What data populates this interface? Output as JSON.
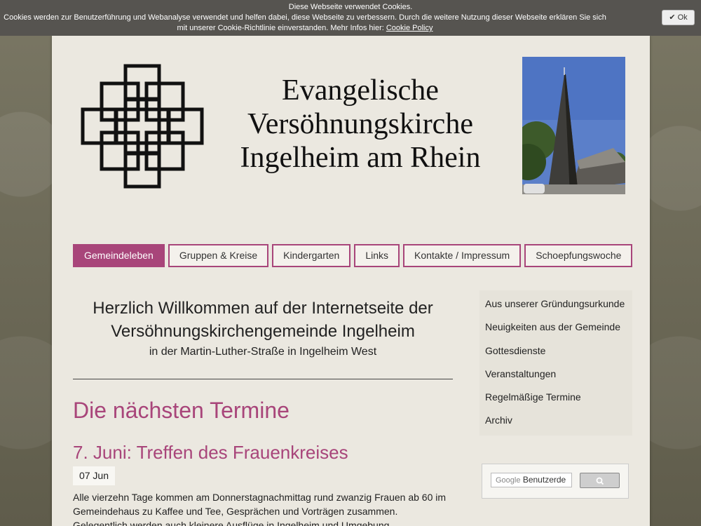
{
  "cookie": {
    "title": "Diese Webseite verwendet Cookies.",
    "text": "Cookies werden zur Benutzerführung und Webanalyse verwendet und helfen dabei, diese Webseite zu verbessern. Durch die weitere Nutzung dieser Webseite erklären Sie sich mit unserer Cookie-Richtlinie einverstanden. Mehr Infos hier: ",
    "link": "Cookie Policy",
    "ok_label": "Ok"
  },
  "header": {
    "line1": "Evangelische",
    "line2": "Versöhnungskirche",
    "line3": "Ingelheim am Rhein"
  },
  "nav": {
    "items": [
      "Gemeindeleben",
      "Gruppen & Kreise",
      "Kindergarten",
      "Links",
      "Kontakte / Impressum",
      "Schoepfungswoche"
    ]
  },
  "main": {
    "welcome_line1": "Herzlich Willkommen auf der Internetseite der",
    "welcome_line2": "Versöhnungskirchengemeinde Ingelheim",
    "welcome_sub": "in der Martin-Luther-Straße in Ingelheim West",
    "section_title": "Die nächsten Termine",
    "event_title": "7. Juni: Treffen des Frauenkreises",
    "event_date": "07  Jun",
    "event_text": "Alle vierzehn Tage kommen am Donnerstagnachmittag rund zwanzig Frauen ab 60 im Gemeindehaus zu Kaffee und Tee, Gesprächen und Vorträgen zusammen. Gelegentlich werden auch kleinere Ausflüge in Ingelheim und Umgebung unternommen. Folgende"
  },
  "sidebar": {
    "items": [
      "Aus unserer Gründungsurkunde",
      "Neuigkeiten aus der Gemeinde",
      "Gottesdienste",
      "Veranstaltungen",
      "Regelmäßige Termine",
      "Archiv"
    ],
    "search_brand": "Google",
    "search_placeholder": "Benutzerde"
  },
  "colors": {
    "accent": "#a8457a",
    "page_bg": "#ebe8e0",
    "cookie_bg": "#565450"
  }
}
